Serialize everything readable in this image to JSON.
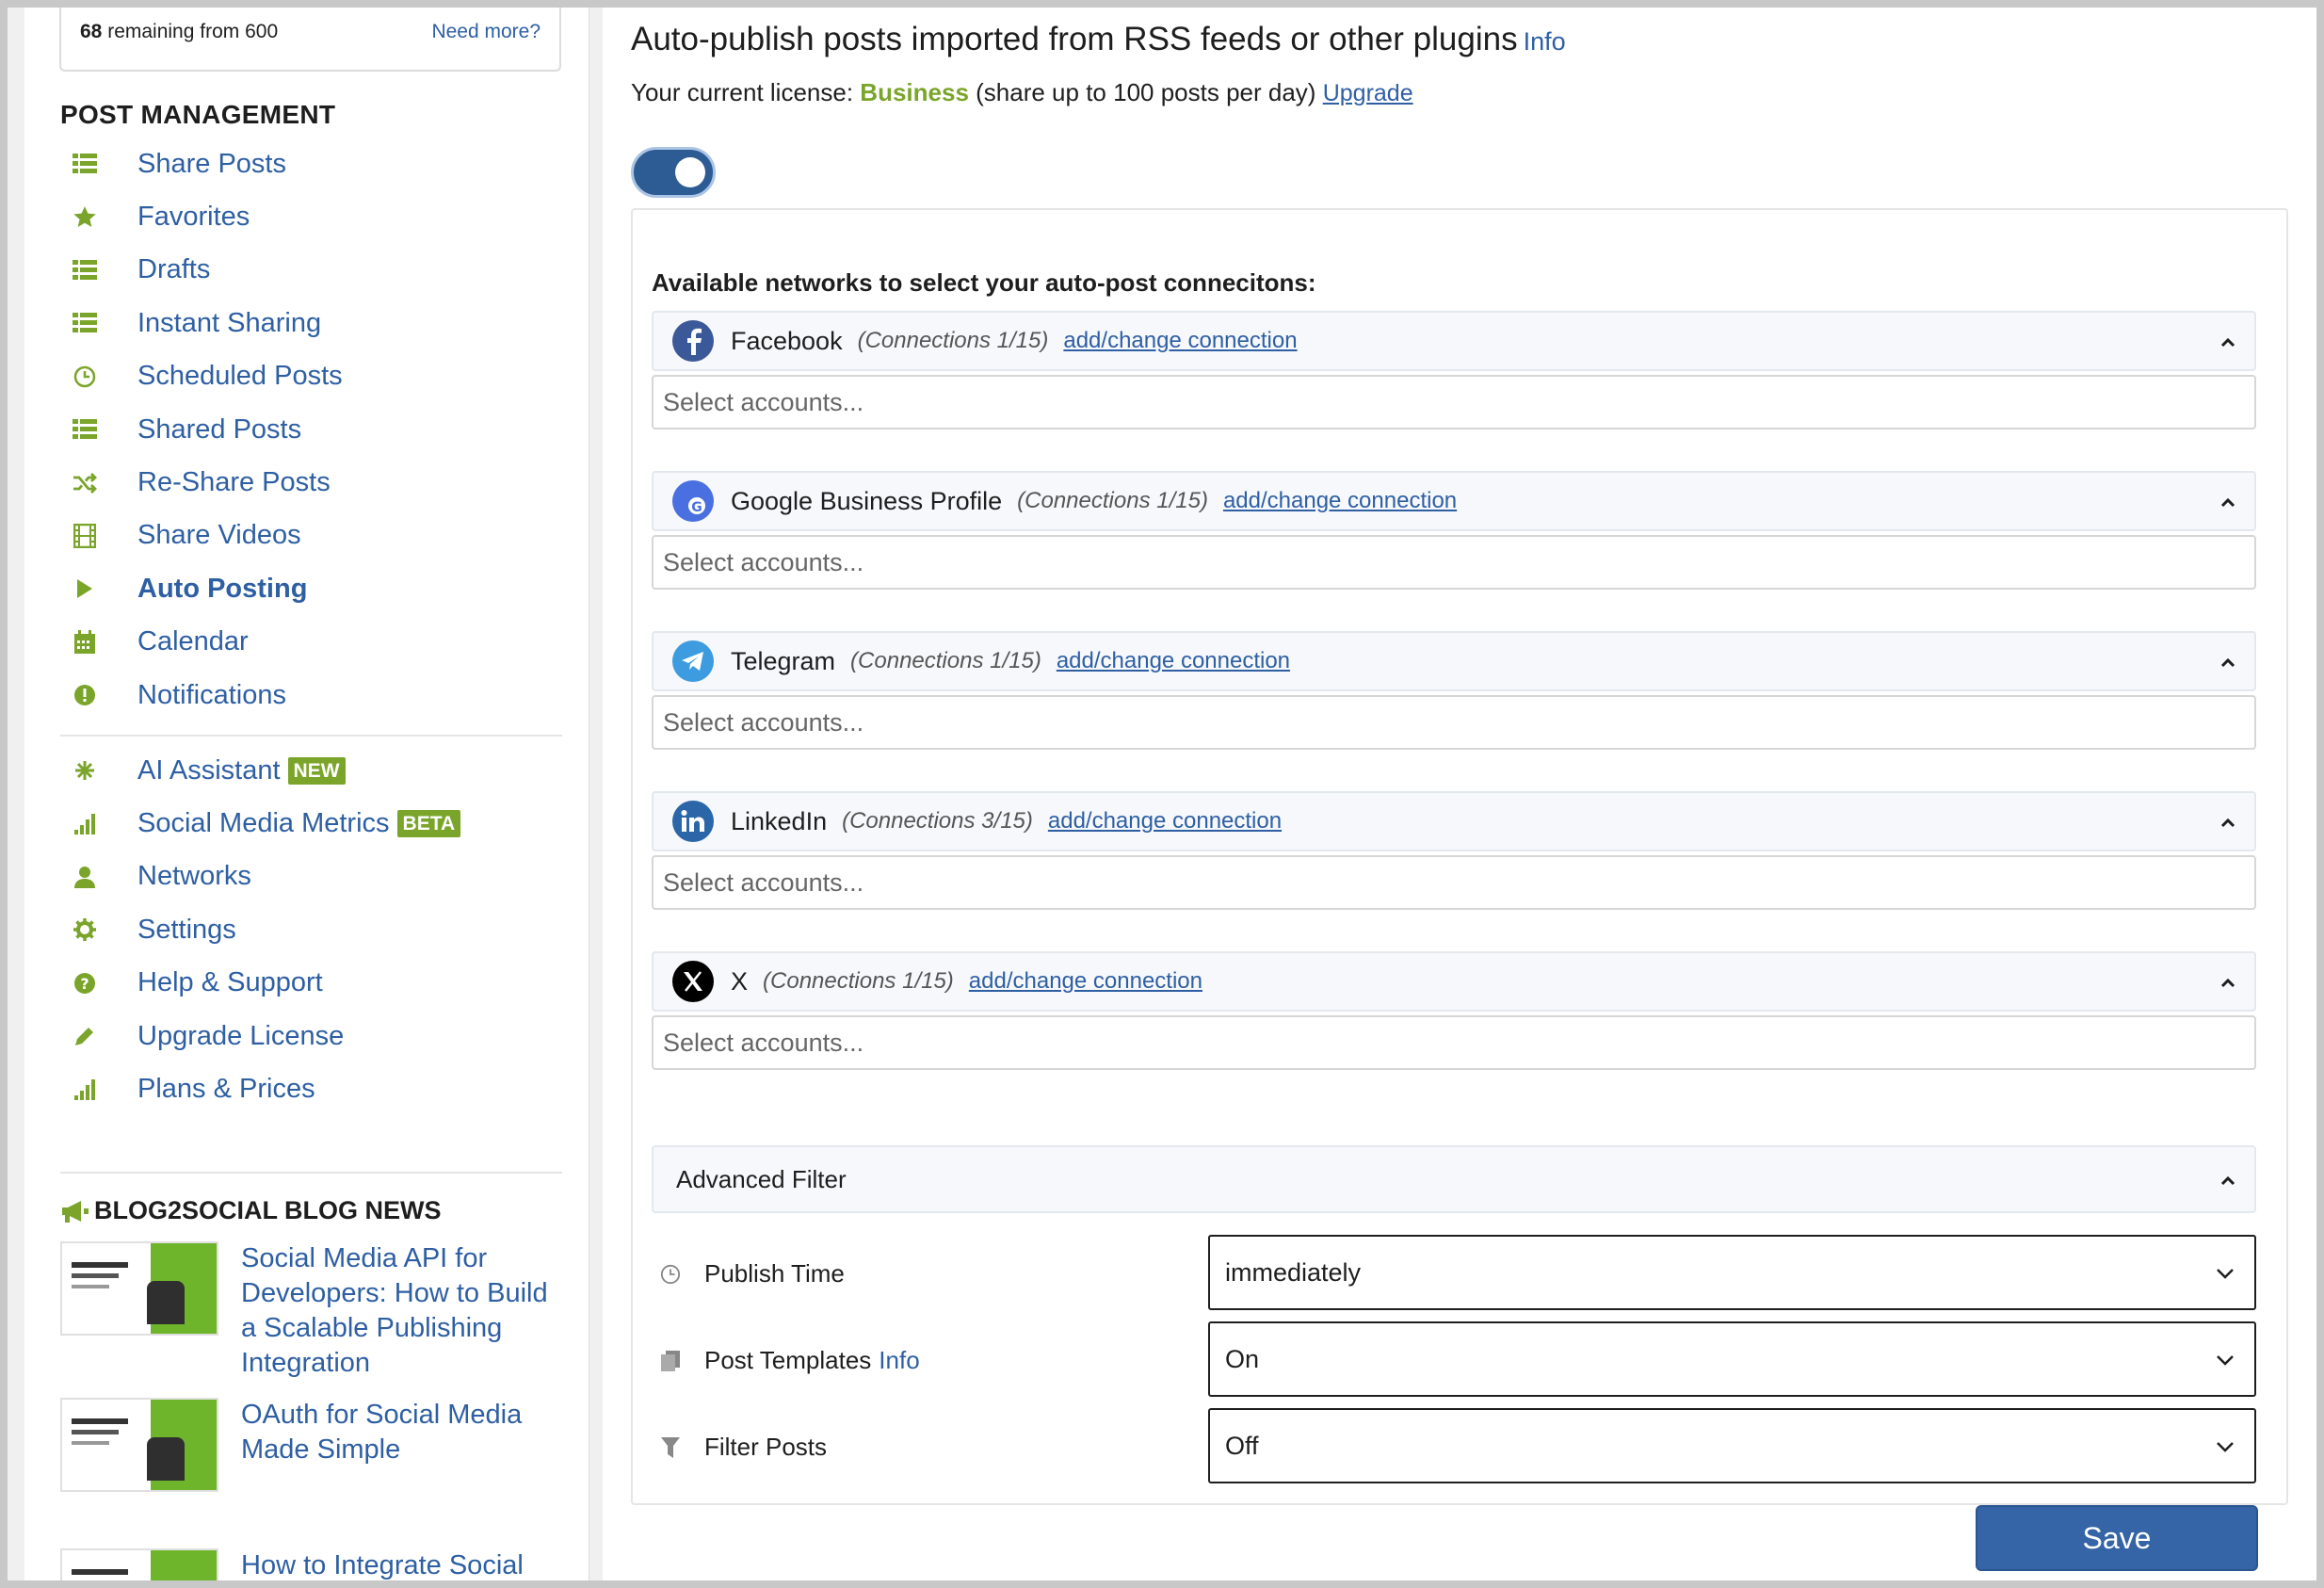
{
  "credits": {
    "used": "68",
    "remaining_text": "remaining from 600",
    "need_more": "Need more?"
  },
  "sidebar": {
    "section_title": "POST MANAGEMENT",
    "items": [
      {
        "label": "Share Posts",
        "icon": "list-icon"
      },
      {
        "label": "Favorites",
        "icon": "star-icon"
      },
      {
        "label": "Drafts",
        "icon": "list-icon"
      },
      {
        "label": "Instant Sharing",
        "icon": "list-icon"
      },
      {
        "label": "Scheduled Posts",
        "icon": "clock-icon"
      },
      {
        "label": "Shared Posts",
        "icon": "list-icon"
      },
      {
        "label": "Re-Share Posts",
        "icon": "shuffle-icon"
      },
      {
        "label": "Share Videos",
        "icon": "film-icon"
      },
      {
        "label": "Auto Posting",
        "icon": "play-icon",
        "active": true
      },
      {
        "label": "Calendar",
        "icon": "calendar-icon"
      },
      {
        "label": "Notifications",
        "icon": "alert-icon"
      }
    ],
    "items2": [
      {
        "label": "AI Assistant",
        "icon": "sparkle-icon",
        "badge": "NEW"
      },
      {
        "label": "Social Media Metrics",
        "icon": "bar-chart-icon",
        "badge": "BETA"
      },
      {
        "label": "Networks",
        "icon": "user-icon"
      },
      {
        "label": "Settings",
        "icon": "gear-icon"
      },
      {
        "label": "Help & Support",
        "icon": "question-icon"
      },
      {
        "label": "Upgrade License",
        "icon": "pencil-icon"
      },
      {
        "label": "Plans & Prices",
        "icon": "bar-chart-icon"
      }
    ],
    "news_title": "BLOG2SOCIAL BLOG NEWS",
    "news": [
      {
        "title": "Social Media API for Developers: How to Build a Scalable Publishing Integration"
      },
      {
        "title": "OAuth for Social Media Made Simple"
      },
      {
        "title": "How to Integrate Social"
      }
    ]
  },
  "main": {
    "heading": "Auto-publish posts imported from RSS feeds or other plugins",
    "heading_info": "Info",
    "license_prefix": "Your current license:",
    "license_name": "Business",
    "license_suffix": "(share up to 100 posts per day)",
    "upgrade": "Upgrade",
    "toggle_on": true,
    "networks_heading": "Available networks to select your auto-post conneciton​s:",
    "networks": [
      {
        "name": "Facebook",
        "connections": "(Connections 1/15)",
        "link": "add/change connection",
        "placeholder": "Select accounts...",
        "color": "#3b5998"
      },
      {
        "name": "Google Business Profile",
        "connections": "(Connections 1/15)",
        "link": "add/change connection",
        "placeholder": "Select accounts...",
        "color": "#4a6fe0"
      },
      {
        "name": "Telegram",
        "connections": "(Connections 1/15)",
        "link": "add/change connection",
        "placeholder": "Select accounts...",
        "color": "#3d9be0"
      },
      {
        "name": "LinkedIn",
        "connections": "(Connections 3/15)",
        "link": "add/change connection",
        "placeholder": "Select accounts...",
        "color": "#2b66a8"
      },
      {
        "name": "X",
        "connections": "(Connections 1/15)",
        "link": "add/change connection",
        "placeholder": "Select accounts...",
        "color": "#000000"
      }
    ],
    "advanced_filter": "Advanced Filter",
    "filters": [
      {
        "label": "Publish Time",
        "value": "immediately",
        "icon": "clock-icon"
      },
      {
        "label": "Post Templates",
        "info": "Info",
        "value": "On",
        "icon": "document-icon"
      },
      {
        "label": "Filter Posts",
        "value": "Off",
        "icon": "funnel-icon"
      }
    ],
    "save": "Save"
  }
}
